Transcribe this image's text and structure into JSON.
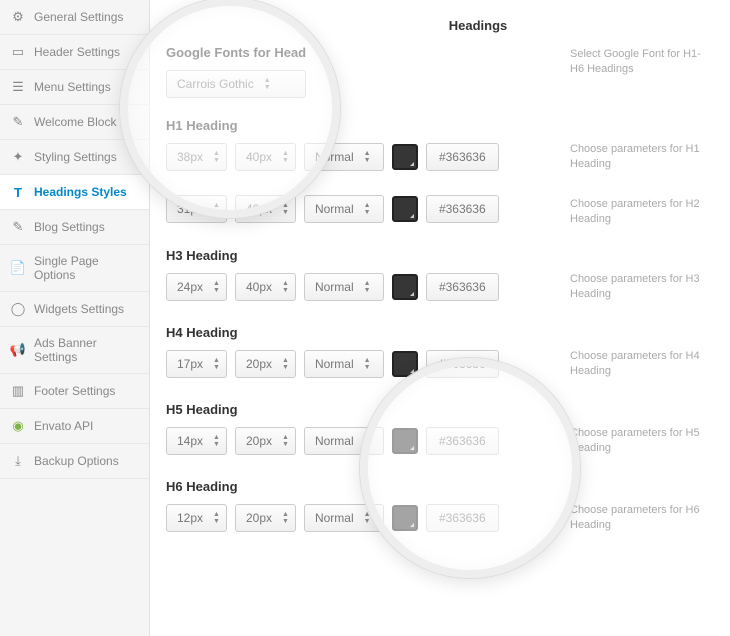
{
  "sidebar": {
    "items": [
      {
        "label": "General Settings",
        "icon": "⚙"
      },
      {
        "label": "Header Settings",
        "icon": "▭"
      },
      {
        "label": "Menu Settings",
        "icon": "☰"
      },
      {
        "label": "Welcome Block",
        "icon": "✎"
      },
      {
        "label": "Styling Settings",
        "icon": "✦"
      },
      {
        "label": "Headings Styles",
        "icon": "T"
      },
      {
        "label": "Blog Settings",
        "icon": "✎"
      },
      {
        "label": "Single Page Options",
        "icon": "📄"
      },
      {
        "label": "Widgets Settings",
        "icon": "◯"
      },
      {
        "label": "Ads Banner Settings",
        "icon": "📢"
      },
      {
        "label": "Footer Settings",
        "icon": "▥"
      },
      {
        "label": "Envato API",
        "icon": "◉"
      },
      {
        "label": "Backup Options",
        "icon": "⤓"
      }
    ]
  },
  "section_title_partial": "Headings",
  "font_section": {
    "label": "Google Fonts for Head",
    "value": "Carrois Gothic",
    "help": "Select Google Font for H1-H6 Headings"
  },
  "headings": [
    {
      "label": "H1 Heading",
      "size": "38px",
      "lh": "40px",
      "weight": "Normal",
      "color": "#363636",
      "help": "Choose parameters for H1 Heading"
    },
    {
      "label": "",
      "size": "31px",
      "lh": "40px",
      "weight": "Normal",
      "color": "#363636",
      "help": "Choose parameters for H2 Heading"
    },
    {
      "label": "H3 Heading",
      "size": "24px",
      "lh": "40px",
      "weight": "Normal",
      "color": "#363636",
      "help": "Choose parameters for H3 Heading"
    },
    {
      "label": "H4 Heading",
      "size": "17px",
      "lh": "20px",
      "weight": "Normal",
      "color": "#363636",
      "help": "Choose parameters for H4 Heading"
    },
    {
      "label": "H5 Heading",
      "size": "14px",
      "lh": "20px",
      "weight": "Normal",
      "color": "#363636",
      "help": "Choose parameters for H5 Heading"
    },
    {
      "label": "H6 Heading",
      "size": "12px",
      "lh": "20px",
      "weight": "Normal",
      "color": "#363636",
      "help": "Choose parameters for H6 Heading"
    }
  ]
}
